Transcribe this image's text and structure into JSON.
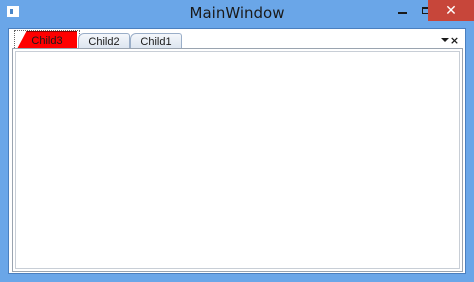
{
  "window": {
    "title": "MainWindow",
    "icons": {
      "app": "app-icon",
      "minimize": "minimize-icon",
      "maximize": "maximize-icon",
      "close": "close-icon"
    },
    "close_glyph": "✕"
  },
  "tabs": [
    {
      "label": "Child3",
      "selected": true,
      "color": "#ff0000"
    },
    {
      "label": "Child2",
      "selected": false
    },
    {
      "label": "Child1",
      "selected": false
    }
  ],
  "tabstrip": {
    "close_glyph": "×",
    "icons": {
      "dropdown": "chevron-down-icon",
      "close": "close-icon"
    }
  }
}
